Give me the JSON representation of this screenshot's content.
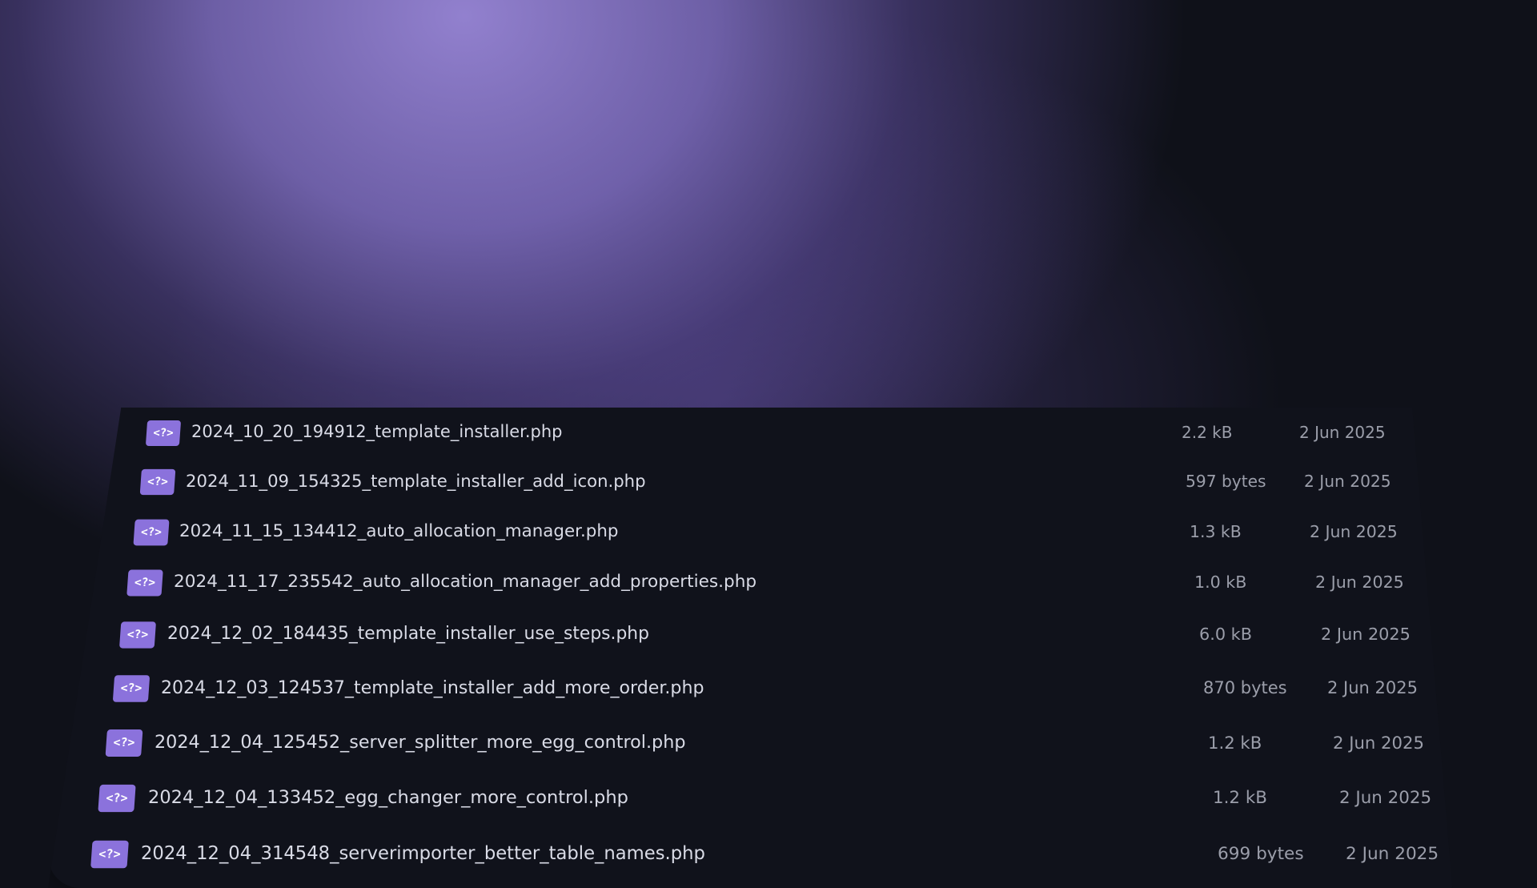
{
  "files": [
    {
      "icon": "php-file-icon",
      "icon_text": "<?>",
      "name": "2024_10_20_194912_template_installer.php",
      "size": "2.2 kB",
      "date": "2 Jun 2025"
    },
    {
      "icon": "php-file-icon",
      "icon_text": "<?>",
      "name": "2024_11_09_154325_template_installer_add_icon.php",
      "size": "597 bytes",
      "date": "2 Jun 2025"
    },
    {
      "icon": "php-file-icon",
      "icon_text": "<?>",
      "name": "2024_11_15_134412_auto_allocation_manager.php",
      "size": "1.3 kB",
      "date": "2 Jun 2025"
    },
    {
      "icon": "php-file-icon",
      "icon_text": "<?>",
      "name": "2024_11_17_235542_auto_allocation_manager_add_properties.php",
      "size": "1.0 kB",
      "date": "2 Jun 2025"
    },
    {
      "icon": "php-file-icon",
      "icon_text": "<?>",
      "name": "2024_12_02_184435_template_installer_use_steps.php",
      "size": "6.0 kB",
      "date": "2 Jun 2025"
    },
    {
      "icon": "php-file-icon",
      "icon_text": "<?>",
      "name": "2024_12_03_124537_template_installer_add_more_order.php",
      "size": "870 bytes",
      "date": "2 Jun 2025"
    },
    {
      "icon": "php-file-icon",
      "icon_text": "<?>",
      "name": "2024_12_04_125452_server_splitter_more_egg_control.php",
      "size": "1.2 kB",
      "date": "2 Jun 2025"
    },
    {
      "icon": "php-file-icon",
      "icon_text": "<?>",
      "name": "2024_12_04_133452_egg_changer_more_control.php",
      "size": "1.2 kB",
      "date": "2 Jun 2025"
    },
    {
      "icon": "php-file-icon",
      "icon_text": "<?>",
      "name": "2024_12_04_314548_serverimporter_better_table_names.php",
      "size": "699 bytes",
      "date": "2 Jun 2025"
    }
  ],
  "colors": {
    "accent": "#8b72dc",
    "background": "#10121b",
    "glow": "#8f7fd0"
  }
}
